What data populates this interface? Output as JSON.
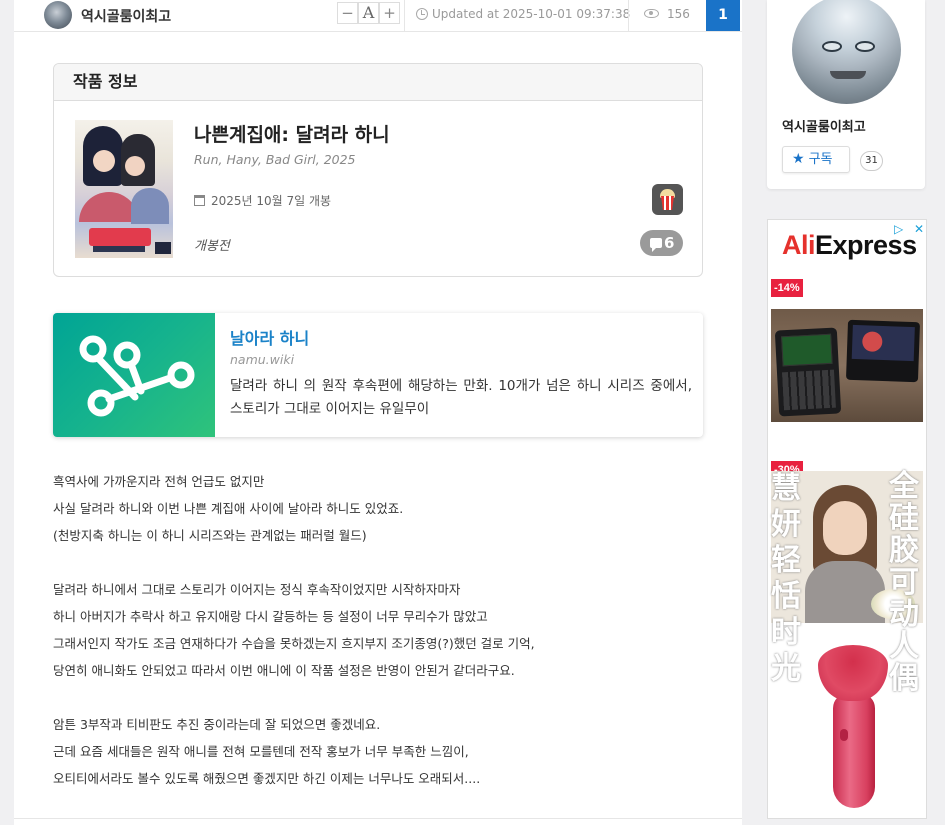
{
  "header": {
    "author": "역시골룸이최고",
    "font_minus": "−",
    "font_label": "A",
    "font_plus": "+",
    "updated": "Updated at 2025-10-01 09:37:38",
    "views": "156",
    "count": "1"
  },
  "work_info": {
    "heading": "작품 정보",
    "title": "나쁜계집애: 달려라 하니",
    "subtitle": "Run, Hany, Bad Girl, 2025",
    "release": "2025년 10월 7일  개봉",
    "status": "개봉전",
    "comments": "6"
  },
  "link_preview": {
    "title": "날아라 하니",
    "domain": "namu.wiki",
    "description": "달려라 하니 의 원작 후속편에 해당하는 만화. 10개가 넘은 하니 시리즈 중에서, 스토리가 그대로 이어지는 유일무이"
  },
  "body": {
    "lines": [
      "흑역사에 가까운지라 전혀 언급도 없지만",
      "사실 달려라 하니와 이번 나쁜 계집애 사이에 날아라 하니도 있었죠.",
      "(천방지축 하니는 이 하니 시리즈와는 관계없는 패러럴 월드)",
      "",
      "달려라 하니에서 그대로 스토리가 이어지는 정식 후속작이었지만 시작하자마자",
      "하니 아버지가 추락사 하고 유지애랑 다시 갈등하는 등 설정이 너무 무리수가 많았고",
      "그래서인지 작가도 조금 연재하다가 수습을 못하겠는지 흐지부지 조기종영(?)했던 걸로 기억,",
      "당연히 애니화도 안되었고 따라서 이번 애니에 이 작품 설정은 반영이 안된거 같더라구요.",
      "",
      "암튼 3부작과 티비판도 추진 중이라는데 잘 되었으면 좋겠네요.",
      "근데 요즘 세대들은 원작 애니를 전혀 모를텐데 전작 홍보가 너무 부족한 느낌이,",
      "오티티에서라도 볼수 있도록 해줬으면 좋겠지만 하긴 이제는 너무나도 오래되서...."
    ]
  },
  "sidebar": {
    "profile_name": "역시골룸이최고",
    "subscribe_label": "구독",
    "subscriber_count": "31"
  },
  "ad": {
    "logo_a": "Ali",
    "logo_b": "Express",
    "choice": "▷",
    "close": "✕",
    "discount1": "-14%",
    "discount2": "-30%",
    "ad_text_left": "慧妍 轻恬时光",
    "ad_text_right": "全硅胶可动人偶"
  }
}
